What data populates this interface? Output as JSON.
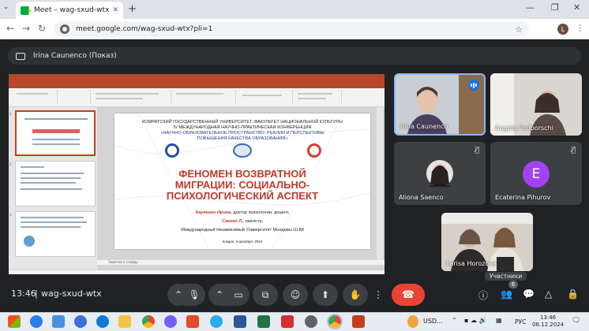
{
  "browser": {
    "tab_title": "Meet – wag-sxud-wtx",
    "url": "meet.google.com/wag-sxud-wtx?pli=1",
    "profile_initial": "L"
  },
  "meet": {
    "presenting_label": "Irina Caunenco (Показ)",
    "time": "13:46",
    "meeting_code": "wag-sxud-wtx",
    "participants_tooltip": "Участники",
    "participants_count": "6",
    "participants": [
      {
        "name": "Irina Caunenco",
        "speaking": true
      },
      {
        "name": "Angela Podborschi",
        "muted": false
      },
      {
        "name": "Aliona Saenco",
        "muted": true
      },
      {
        "name": "Ecaterina Pihurov",
        "muted": true,
        "avatar_letter": "E",
        "avatar_color": "#a142f4"
      },
      {
        "name": "Larisa Horozova"
      }
    ]
  },
  "slide": {
    "line1": "КОМРАТСКИЙ ГОСУДАРСТВЕННЫЙ УНИВЕРСИТЕТ, ФАКУЛЬТЕТ НАЦИОНАЛЬНОЙ КУЛЬТУРЫ",
    "line2": "IV МЕЖДУНАРОДНАЯ НАУЧНО-ПРАКТИЧЕСКАЯ КОНФЕРЕНЦИЯ",
    "line3": "«НАУЧНО-ОБРАЗОВАТЕЛЬНОЕ ПРОСТРАНСТВО: РЕАЛИИ И ПЕРСПЕКТИВЫ",
    "line4": "ПОВЫШЕНИЯ КАЧЕСТВА ОБРАЗОВАНИЯ»",
    "title1": "ФЕНОМЕН ВОЗВРАТНОЙ",
    "title2": "МИГРАЦИИ: СОЦИАЛЬНО-",
    "title3": "ПСИХОЛОГИЧЕСКИЙ АСПЕКТ",
    "author1_name": "Кауненко Ирина,",
    "author1_role": " доктор психологии, доцент,",
    "author2_name": "Саенко Л.,",
    "author2_role": " магистр,",
    "affiliation": "Международный Независимый Университет Молдовы ULIM",
    "footer": "Комрат, 6 декабря, 2024",
    "notes": "Заметки к слайду"
  },
  "taskbar": {
    "currency": "USD...",
    "lang": "РУС",
    "clock_time": "13:46",
    "clock_date": "06.12.2024"
  },
  "colors": {
    "accent": "#1a73e8",
    "leave": "#ea4335",
    "ppt": "#c43e1c"
  }
}
